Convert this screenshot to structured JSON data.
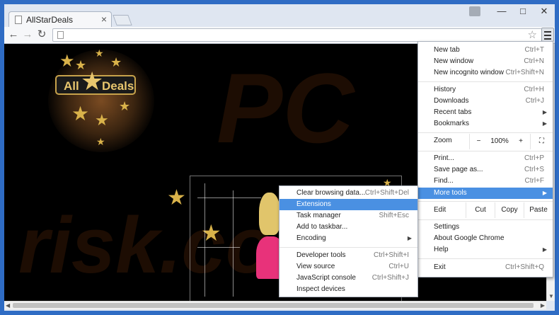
{
  "tab": {
    "title": "AllStarDeals"
  },
  "window_controls": {
    "minimize": "—",
    "maximize": "□",
    "close": "✕"
  },
  "toolbar": {
    "back_icon": "back-arrow-icon",
    "forward_icon": "forward-arrow-icon",
    "reload_icon": "reload-icon",
    "address": ""
  },
  "logo": {
    "left": "All",
    "right": "Deals"
  },
  "watermark": {
    "top": "PC",
    "bottom": "risk.com"
  },
  "chrome_menu": {
    "items": [
      {
        "label": "New tab",
        "shortcut": "Ctrl+T"
      },
      {
        "label": "New window",
        "shortcut": "Ctrl+N"
      },
      {
        "label": "New incognito window",
        "shortcut": "Ctrl+Shift+N"
      },
      {
        "label": "History",
        "shortcut": "Ctrl+H"
      },
      {
        "label": "Downloads",
        "shortcut": "Ctrl+J"
      },
      {
        "label": "Recent tabs",
        "shortcut": ""
      },
      {
        "label": "Bookmarks",
        "shortcut": ""
      },
      {
        "label": "Print...",
        "shortcut": "Ctrl+P"
      },
      {
        "label": "Save page as...",
        "shortcut": "Ctrl+S"
      },
      {
        "label": "Find...",
        "shortcut": "Ctrl+F"
      },
      {
        "label": "More tools",
        "shortcut": ""
      },
      {
        "label": "Settings",
        "shortcut": ""
      },
      {
        "label": "About Google Chrome",
        "shortcut": ""
      },
      {
        "label": "Help",
        "shortcut": ""
      },
      {
        "label": "Exit",
        "shortcut": "Ctrl+Shift+Q"
      }
    ],
    "zoom": {
      "label": "Zoom",
      "minus": "−",
      "value": "100%",
      "plus": "+",
      "fullscreen_icon": "fullscreen-icon"
    },
    "edit": {
      "label": "Edit",
      "cut": "Cut",
      "copy": "Copy",
      "paste": "Paste"
    }
  },
  "more_tools_menu": {
    "items": [
      {
        "label": "Clear browsing data...",
        "shortcut": "Ctrl+Shift+Del"
      },
      {
        "label": "Extensions",
        "shortcut": ""
      },
      {
        "label": "Task manager",
        "shortcut": "Shift+Esc"
      },
      {
        "label": "Add to taskbar...",
        "shortcut": ""
      },
      {
        "label": "Encoding",
        "shortcut": ""
      },
      {
        "label": "Developer tools",
        "shortcut": "Ctrl+Shift+I"
      },
      {
        "label": "View source",
        "shortcut": "Ctrl+U"
      },
      {
        "label": "JavaScript console",
        "shortcut": "Ctrl+Shift+J"
      },
      {
        "label": "Inspect devices",
        "shortcut": ""
      }
    ]
  },
  "colors": {
    "accent": "#4a90e2",
    "frame": "#2f6cc4",
    "logo_gold": "#e8c66e",
    "dress_pink": "#e8327a"
  }
}
